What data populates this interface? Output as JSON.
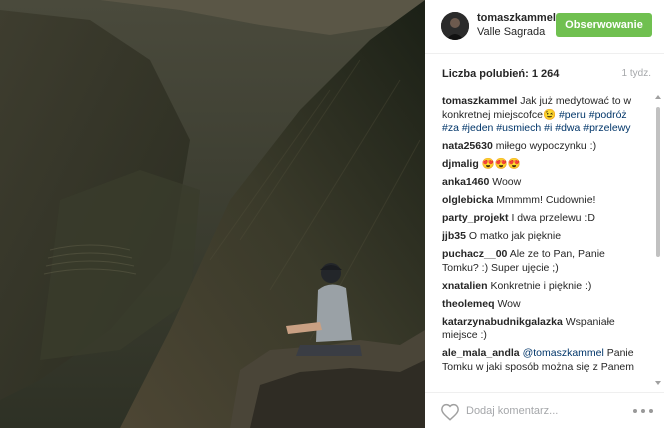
{
  "post": {
    "username": "tomaszkammel",
    "location": "Valle Sagrada",
    "follow_label": "Obserwowanie",
    "likes_text": "Liczba polubień: 1 264",
    "time_ago": "1 tydz."
  },
  "caption": {
    "author": "tomaszkammel",
    "text": "Jak już medytować to w konkretnej miejscofce😉",
    "hashtags": "#peru #podróż #za #jeden #usmiech #i #dwa #przelewy"
  },
  "comments": [
    {
      "author": "nata25630",
      "text": "miłego wypoczynku :)"
    },
    {
      "author": "djmalig",
      "text": "😍😍😍"
    },
    {
      "author": "anka1460",
      "text": "Woow"
    },
    {
      "author": "olglebicka",
      "text": "Mmmmm! Cudownie!"
    },
    {
      "author": "party_projekt",
      "text": "I dwa przelewu :D"
    },
    {
      "author": "jjb35",
      "text": "O matko jak pięknie"
    },
    {
      "author": "puchacz__00",
      "text": "Ale ze to Pan, Panie Tomku? :) Super ujęcie ;)"
    },
    {
      "author": "xnatalien",
      "text": "Konkretnie i pięknie :)"
    },
    {
      "author": "theolemeq",
      "text": "Wow"
    },
    {
      "author": "katarzynabudnikgalazka",
      "text": "Wspaniałe miejsce :)"
    }
  ],
  "last_comment": {
    "author": "ale_mala_andla",
    "mention": "@tomaszkammel",
    "text": "Panie Tomku w jaki sposób można się z Panem"
  },
  "footer": {
    "comment_placeholder": "Dodaj komentarz...",
    "heart_icon": "heart-outline-icon",
    "more_icon": "more-options-icon"
  },
  "colors": {
    "follow_button": "#70c050",
    "link": "#003569",
    "muted": "#a5a7aa"
  }
}
